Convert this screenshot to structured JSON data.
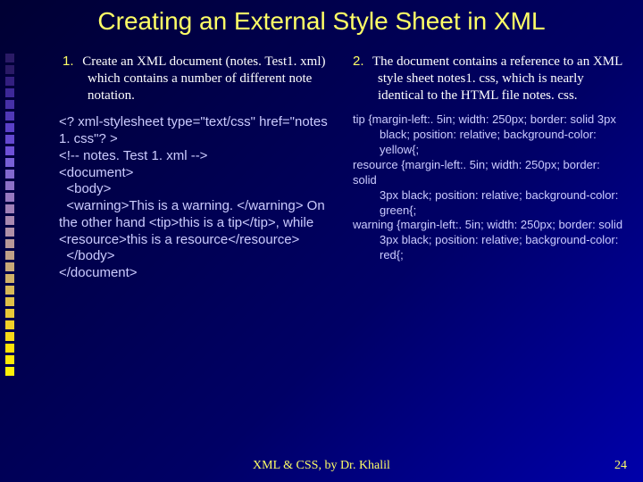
{
  "title": "Creating an External Style Sheet in XML",
  "left": {
    "num": "1.",
    "text": "Create an XML document (notes. Test1. xml) which contains a number of different note notation.",
    "code": "<? xml-stylesheet type=\"text/css\" href=\"notes 1. css\"? >\n<!-- notes. Test 1. xml -->\n<document>\n  <body>\n  <warning>This is a warning. </warning> On the other hand <tip>this is a tip</tip>, while <resource>this is a resource</resource>\n  </body>\n</document>"
  },
  "right": {
    "num": "2.",
    "text": "The document contains a reference to an XML style sheet notes1. css, which is nearly identical to the HTML file notes. css.",
    "css1a": "tip {margin-left:. 5in; width: 250px; border: solid 3px",
    "css1b": "black; position: relative; background-color: yellow{;",
    "css2a": "resource {margin-left:. 5in; width: 250px; border: solid",
    "css2b": "3px black; position: relative; background-color: green{;",
    "css3a": "warning {margin-left:. 5in; width: 250px; border: solid",
    "css3b": "3px black; position: relative; background-color: red{;"
  },
  "footer": "XML & CSS, by Dr. Khalil",
  "page": "24"
}
